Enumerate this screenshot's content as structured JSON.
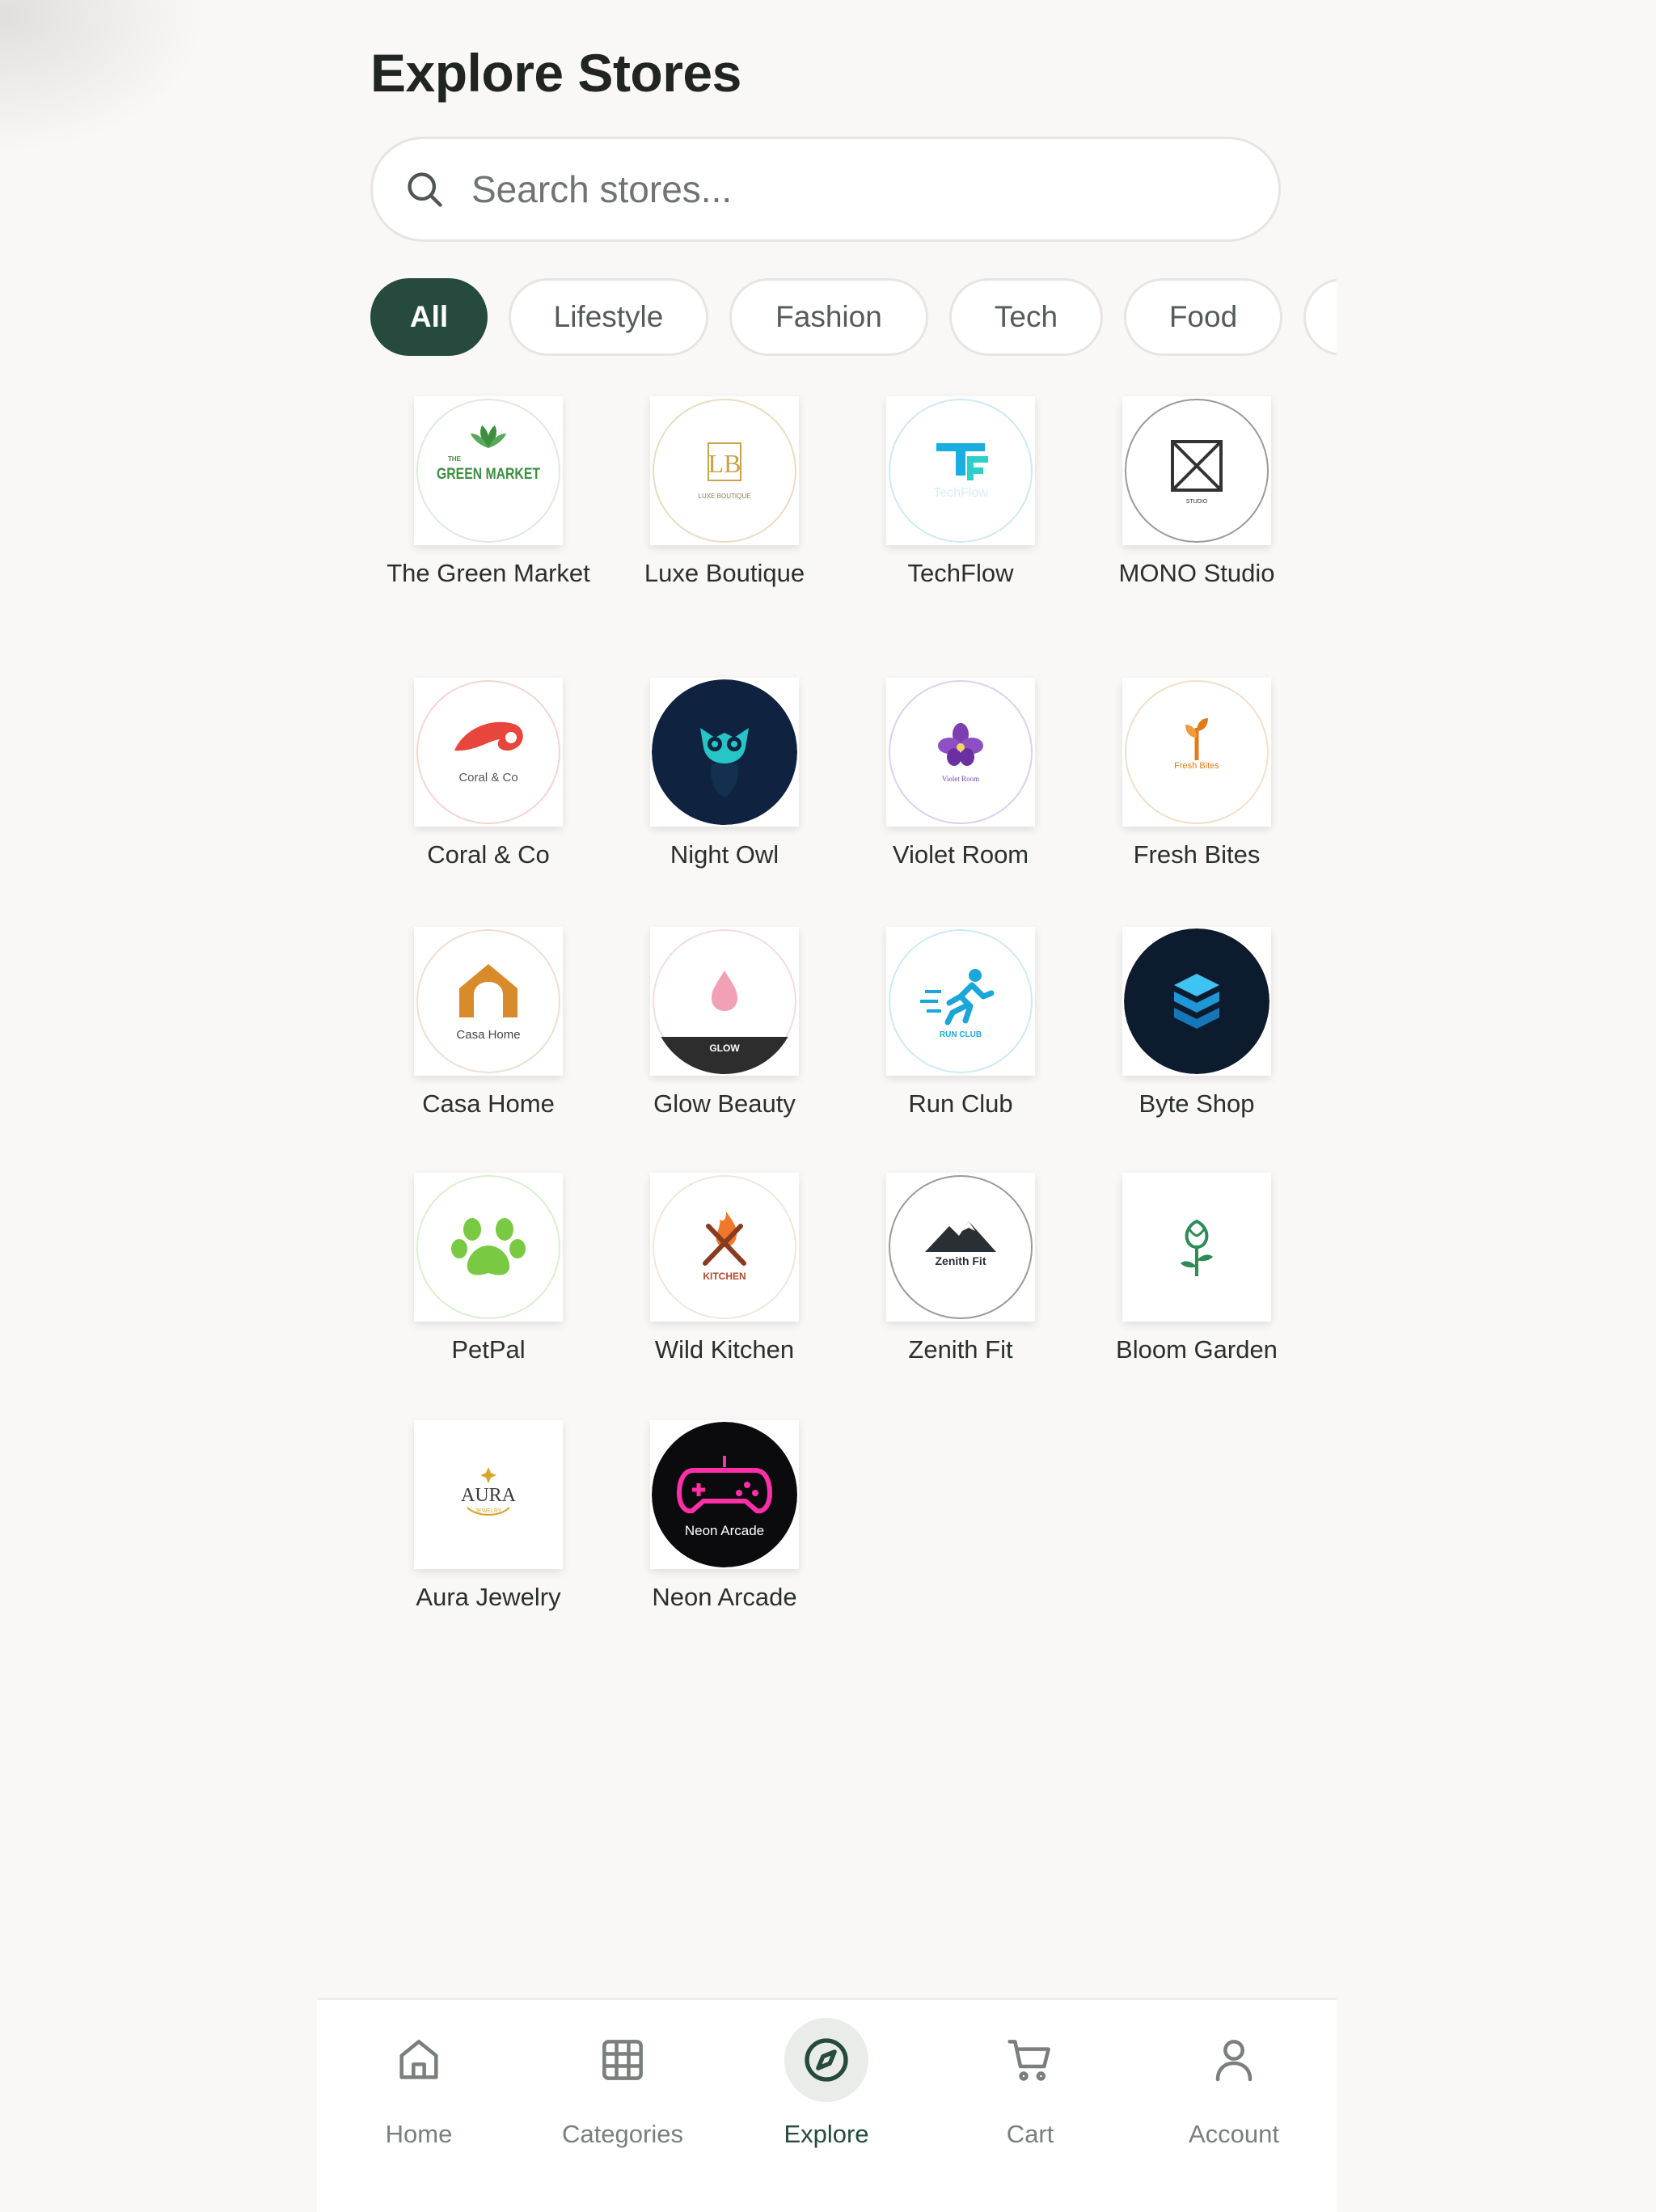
{
  "page": {
    "title": "Explore Stores"
  },
  "search": {
    "placeholder": "Search stores..."
  },
  "filters": [
    {
      "label": "All",
      "active": true
    },
    {
      "label": "Lifestyle"
    },
    {
      "label": "Fashion"
    },
    {
      "label": "Tech"
    },
    {
      "label": "Food"
    }
  ],
  "stores": [
    {
      "name": "The Green Market",
      "logo_text": "GREEN MARKET",
      "logo_text2": "THE",
      "logo_icon": "leaf-icon"
    },
    {
      "name": "Luxe Boutique",
      "logo_text": "LUXE BOUTIQUE",
      "logo_text2": "LB",
      "logo_icon": "monogram-icon"
    },
    {
      "name": "TechFlow",
      "logo_text": "TechFlow",
      "logo_text2": "TF",
      "logo_icon": "tf-monogram-icon"
    },
    {
      "name": "MONO Studio",
      "logo_text": "STUDIO",
      "logo_icon": "crossed-square-icon"
    },
    {
      "name": "Coral & Co",
      "logo_text": "Coral & Co",
      "logo_icon": "coral-wave-icon"
    },
    {
      "name": "Night Owl",
      "logo_icon": "owl-icon"
    },
    {
      "name": "Violet Room",
      "logo_text": "Violet Room",
      "logo_icon": "violet-flower-icon"
    },
    {
      "name": "Fresh Bites",
      "logo_text": "Fresh Bites",
      "logo_icon": "sprout-icon"
    },
    {
      "name": "Casa Home",
      "logo_text": "Casa Home",
      "logo_icon": "arch-house-icon"
    },
    {
      "name": "Glow Beauty",
      "logo_text": "GLOW",
      "logo_icon": "droplet-icon"
    },
    {
      "name": "Run Club",
      "logo_text": "RUN CLUB",
      "logo_icon": "runner-icon"
    },
    {
      "name": "Byte Shop",
      "logo_icon": "cube-stack-icon"
    },
    {
      "name": "PetPal",
      "logo_icon": "paw-icon"
    },
    {
      "name": "Wild Kitchen",
      "logo_text": "KITCHEN",
      "logo_icon": "flame-utensils-icon"
    },
    {
      "name": "Zenith Fit",
      "logo_text": "Zenith Fit",
      "logo_icon": "mountain-icon"
    },
    {
      "name": "Bloom Garden",
      "logo_icon": "tulip-icon"
    },
    {
      "name": "Aura Jewelry",
      "logo_text": "AURA",
      "logo_text2": "JEWELRY",
      "logo_icon": "sparkle-icon"
    },
    {
      "name": "Neon Arcade",
      "logo_text": "Neon Arcade",
      "logo_icon": "gamepad-icon"
    }
  ],
  "nav": [
    {
      "label": "Home",
      "icon": "home-icon"
    },
    {
      "label": "Categories",
      "icon": "grid-icon"
    },
    {
      "label": "Explore",
      "icon": "compass-icon",
      "active": true
    },
    {
      "label": "Cart",
      "icon": "cart-icon"
    },
    {
      "label": "Account",
      "icon": "user-icon"
    }
  ],
  "colors": {
    "accent": "#264a3d",
    "background": "#faf8f6"
  }
}
